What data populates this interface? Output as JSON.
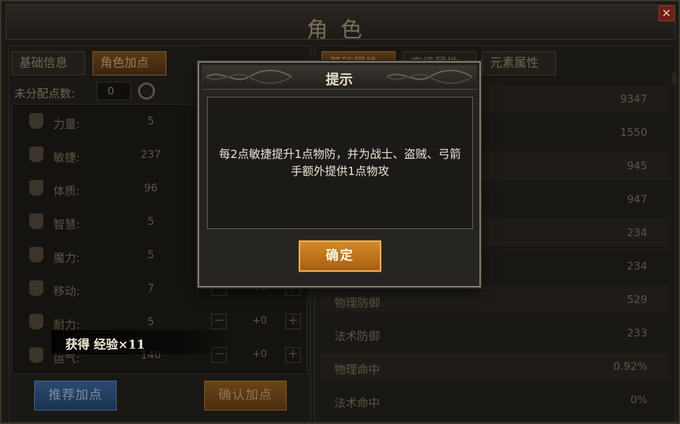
{
  "window": {
    "title": "角色",
    "close": "✕"
  },
  "left_tabs": [
    {
      "label": "基础信息",
      "active": false
    },
    {
      "label": "角色加点",
      "active": true
    }
  ],
  "right_tabs": [
    {
      "label": "基础属性",
      "active": true
    },
    {
      "label": "高级属性",
      "active": false
    },
    {
      "label": "元素属性",
      "active": false
    }
  ],
  "unallocated": {
    "label": "未分配点数:",
    "value": "0"
  },
  "attributes": [
    {
      "icon": "strength-icon",
      "label": "力量:",
      "value": "5",
      "add": ""
    },
    {
      "icon": "agility-icon",
      "label": "敏捷:",
      "value": "237",
      "add": ""
    },
    {
      "icon": "constitution-icon",
      "label": "体质:",
      "value": "96",
      "add": ""
    },
    {
      "icon": "wisdom-icon",
      "label": "智慧:",
      "value": "5",
      "add": ""
    },
    {
      "icon": "magic-icon",
      "label": "魔力:",
      "value": "5",
      "add": ""
    },
    {
      "icon": "movement-icon",
      "label": "移动:",
      "value": "7",
      "add": "+0"
    },
    {
      "icon": "endurance-icon",
      "label": "耐力:",
      "value": "5",
      "add": "+0"
    },
    {
      "icon": "luck-icon",
      "label": "运气:",
      "value": "140",
      "add": "+0"
    }
  ],
  "buttons": {
    "recommend": "推荐加点",
    "confirm_points": "确认加点"
  },
  "stats": [
    {
      "label": "",
      "value": "9347"
    },
    {
      "label": "",
      "value": "1550"
    },
    {
      "label": "",
      "value": "945"
    },
    {
      "label": "",
      "value": "947"
    },
    {
      "label": "",
      "value": "234"
    },
    {
      "label": "",
      "value": "234"
    },
    {
      "label": "物理防御",
      "value": "529"
    },
    {
      "label": "法术防御",
      "value": "233"
    },
    {
      "label": "物理命中",
      "value": "0.92%"
    },
    {
      "label": "法术命中",
      "value": "0%"
    }
  ],
  "toast": {
    "text": "获得 经验×11"
  },
  "modal": {
    "title": "提示",
    "message": "每2点敏捷提升1点物防，并为战士、盗贼、弓箭手额外提供1点物攻",
    "ok": "确定"
  }
}
